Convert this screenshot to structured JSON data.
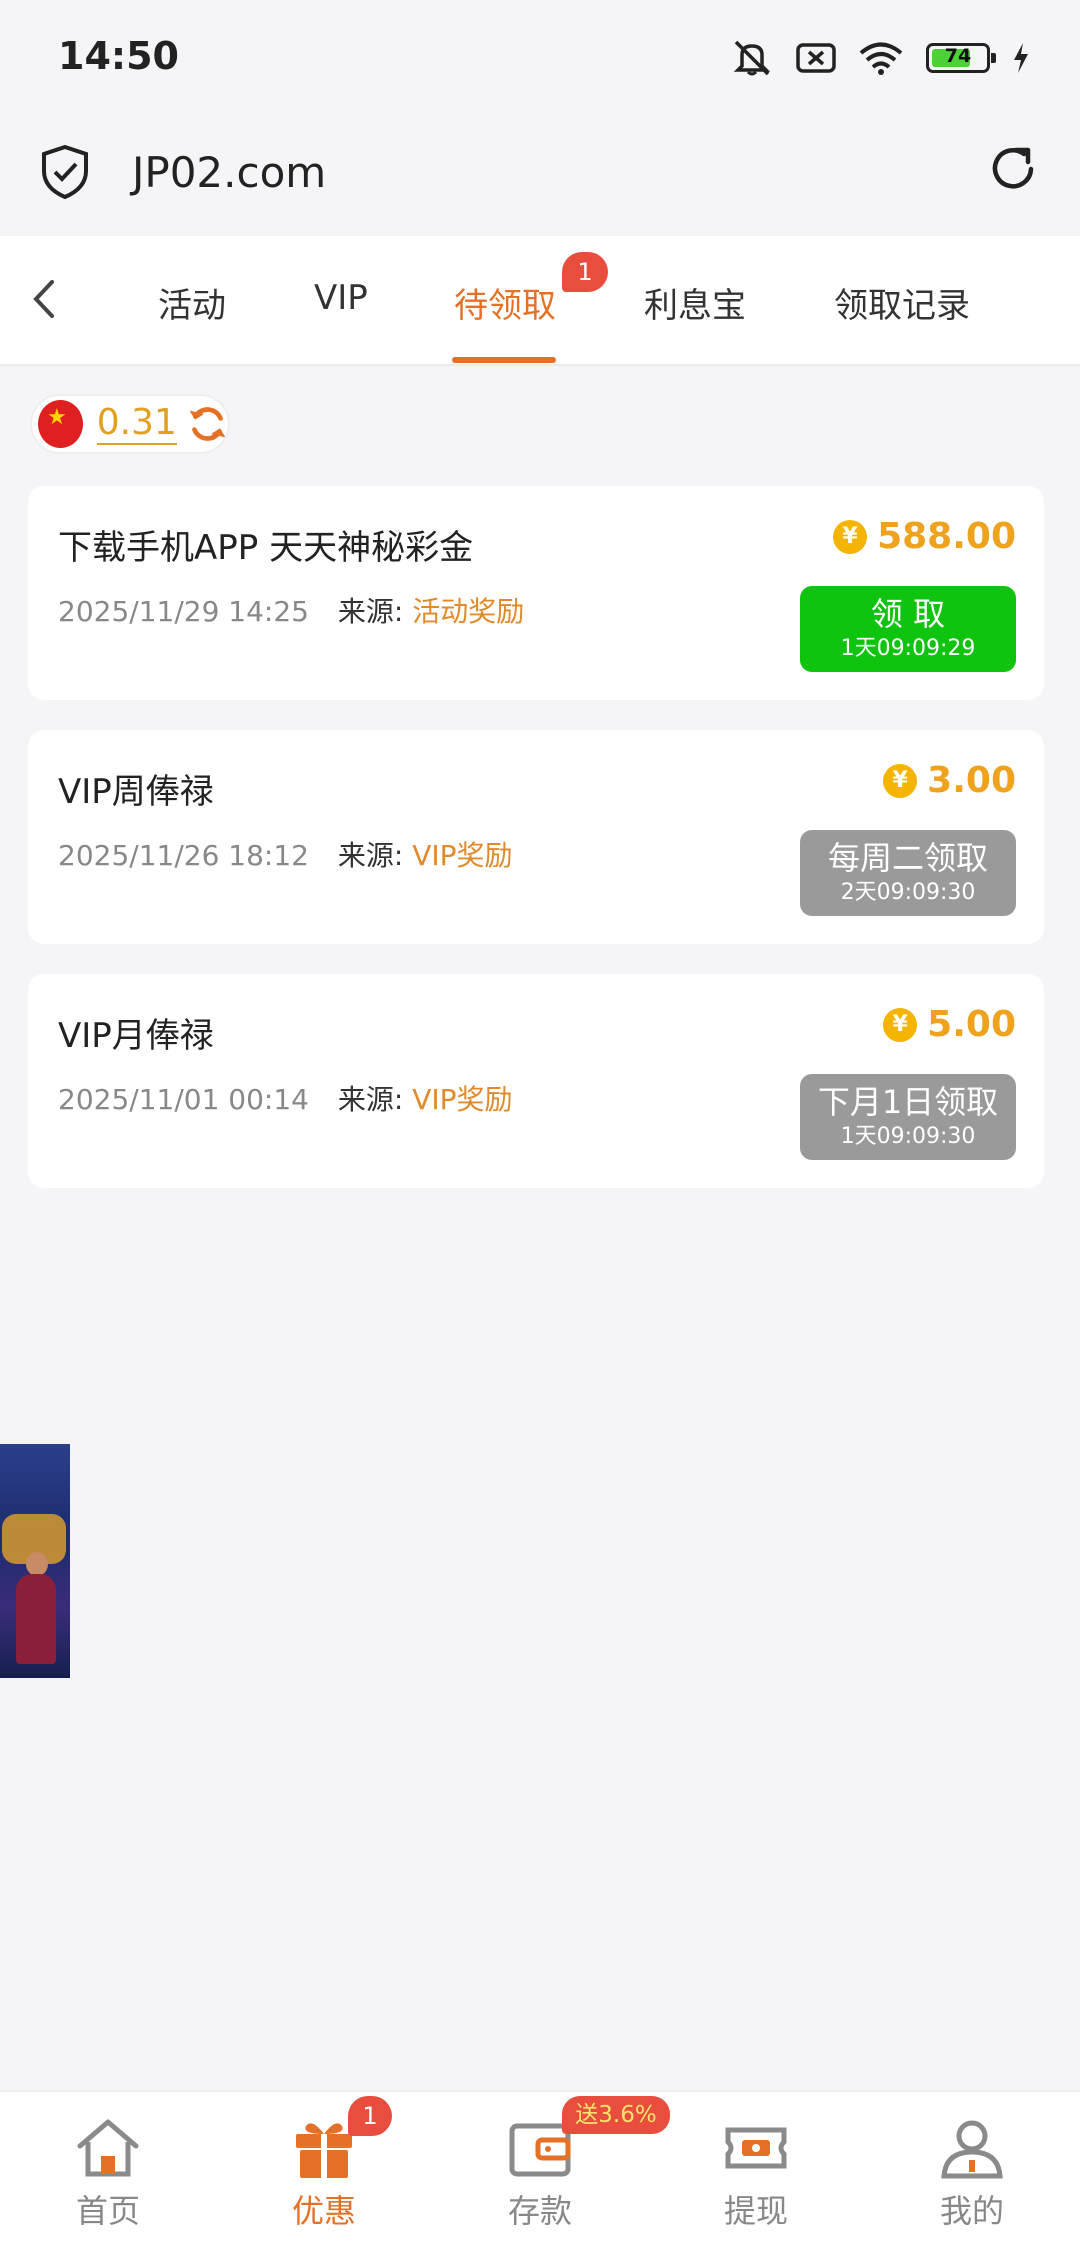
{
  "status_bar": {
    "time": "14:50",
    "battery": "74"
  },
  "browser": {
    "url": "JP02.com"
  },
  "tabs": {
    "items": [
      {
        "label": "活动"
      },
      {
        "label": "VIP"
      },
      {
        "label": "待领取"
      },
      {
        "label": "利息宝"
      },
      {
        "label": "领取记录"
      }
    ],
    "active_index": 2,
    "badge": "1"
  },
  "balance": {
    "value": "0.31"
  },
  "cards": [
    {
      "title": "下载手机APP 天天神秘彩金",
      "date": "2025/11/29 14:25",
      "source_label": "来源:",
      "source": "活动奖励",
      "amount": "588.00",
      "button_main": "领 取",
      "button_sub": "1天09:09:29",
      "button_color": "#0fc40f"
    },
    {
      "title": "VIP周俸禄",
      "date": "2025/11/26 18:12",
      "source_label": "来源:",
      "source": "VIP奖励",
      "amount": "3.00",
      "button_main": "每周二领取",
      "button_sub": "2天09:09:30",
      "button_color": "#9a9a9a"
    },
    {
      "title": "VIP月俸禄",
      "date": "2025/11/01 00:14",
      "source_label": "来源:",
      "source": "VIP奖励",
      "amount": "5.00",
      "button_main": "下月1日领取",
      "button_sub": "1天09:09:30",
      "button_color": "#9a9a9a"
    }
  ],
  "bottom_nav": {
    "items": [
      {
        "label": "首页",
        "icon": "home-icon"
      },
      {
        "label": "优惠",
        "icon": "gift-icon"
      },
      {
        "label": "存款",
        "icon": "wallet-icon"
      },
      {
        "label": "提现",
        "icon": "withdraw-icon"
      },
      {
        "label": "我的",
        "icon": "user-icon"
      }
    ],
    "active_index": 1,
    "badge": "1",
    "promo": "送3.6%"
  },
  "colors": {
    "accent": "#e57126",
    "amount": "#efa21e",
    "claim": "#0fc40f",
    "disabled": "#9a9a9a"
  }
}
